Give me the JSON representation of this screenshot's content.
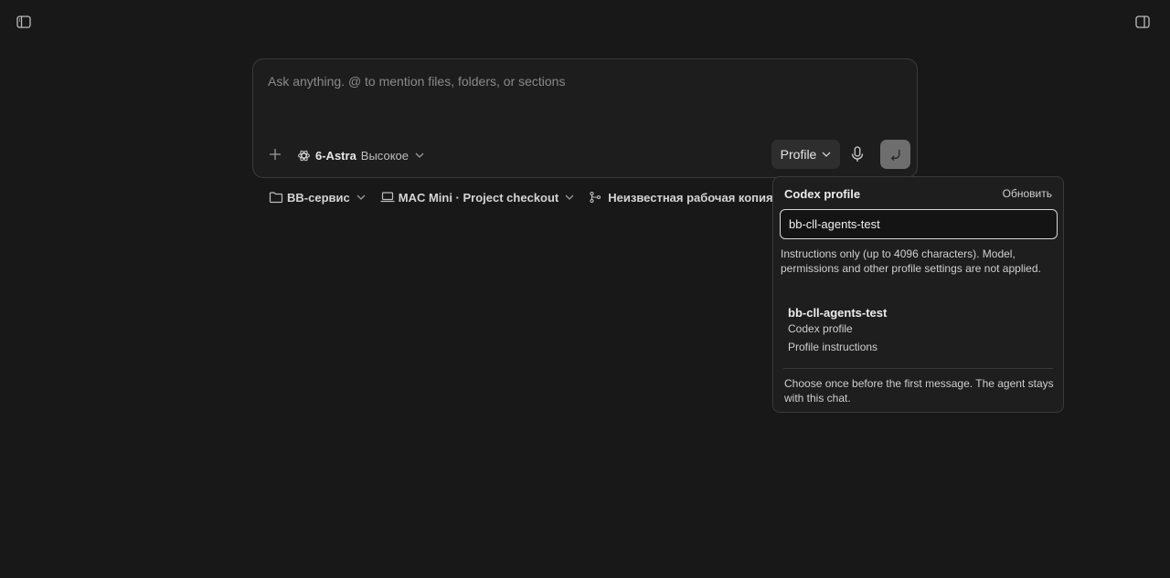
{
  "sidebar_toggle": {
    "icon": "sidebar-left-icon"
  },
  "panel_toggle": {
    "icon": "sidebar-right-icon"
  },
  "composer": {
    "placeholder": "Ask anything. @ to mention files, folders, or sections",
    "model_name": "6-Astra",
    "model_level": "Высокое",
    "profile_label": "Profile"
  },
  "context_bar": {
    "folder": "BB-сервис",
    "machine": "MAC Mini · Project checkout",
    "branch": "Неизвестная рабочая копия"
  },
  "profile_popover": {
    "title": "Codex profile",
    "refresh_label": "Обновить",
    "input_value": "bb-cll-agents-test",
    "note": "Instructions only (up to 4096 characters). Model, permissions and other profile settings are not applied.",
    "option": {
      "name": "bb-cll-agents-test",
      "type": "Codex profile",
      "description": "Profile instructions"
    },
    "footer": "Choose once before the first message. The agent stays with this chat."
  },
  "colors": {
    "background": "#181818",
    "panel": "#1d1d1d",
    "border": "#3a3a3a",
    "send_button": "#6e6e6e"
  }
}
